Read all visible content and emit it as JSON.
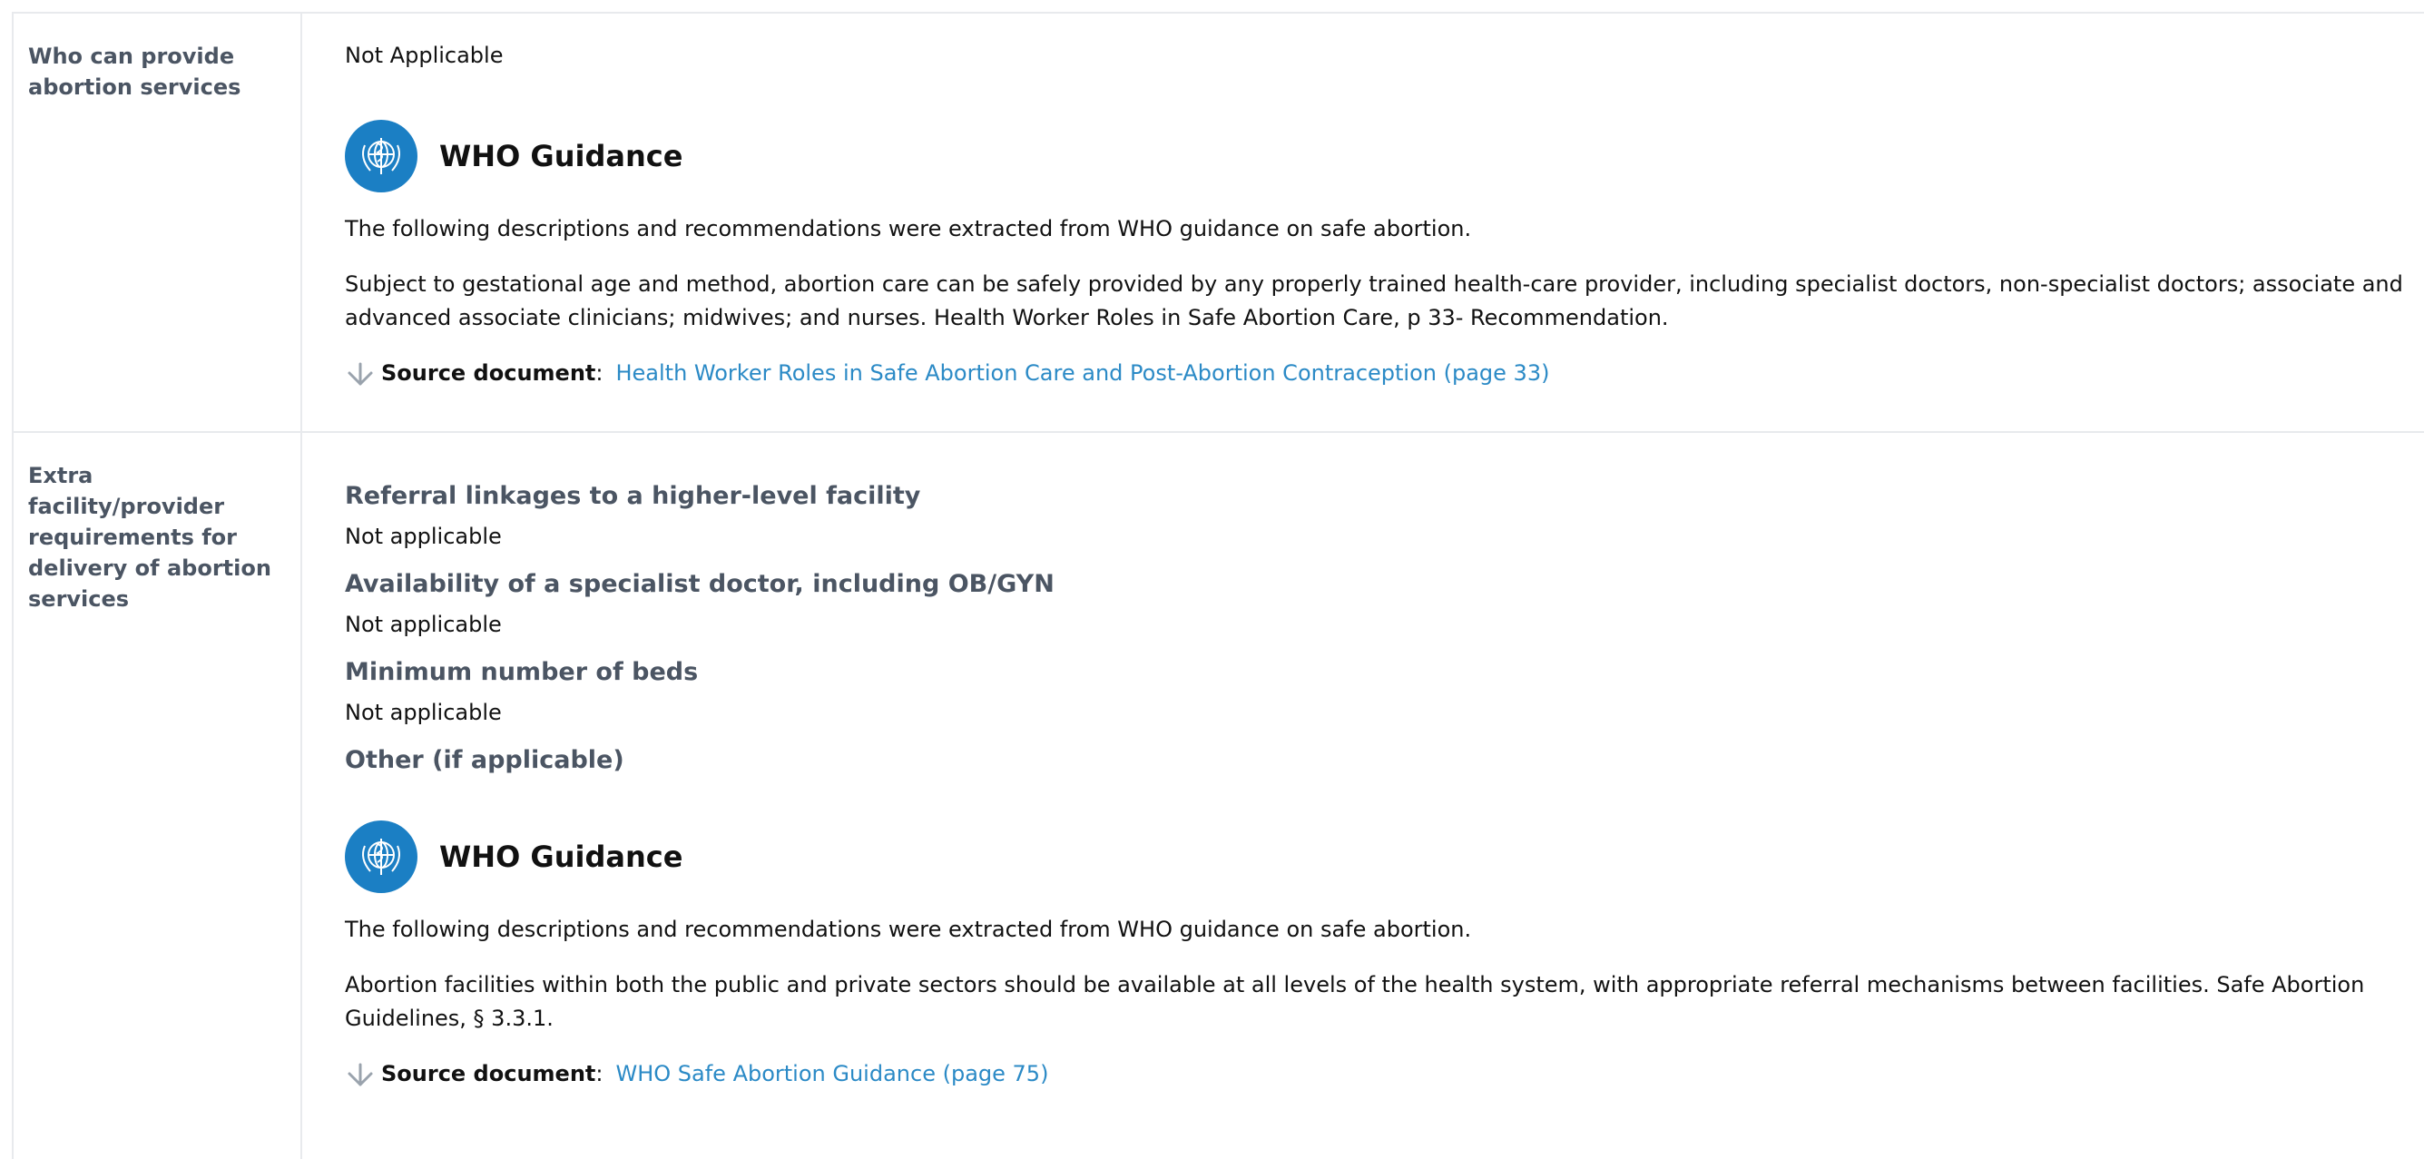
{
  "rows": [
    {
      "label": "Who can provide abortion services",
      "value": "Not Applicable",
      "who": {
        "title": "WHO Guidance",
        "intro": "The following descriptions and recommendations were extracted from WHO guidance on safe abortion.",
        "text": "Subject to gestational age and method, abortion care can be safely provided by any properly trained health-care provider, including specialist doctors, non-specialist doctors; associate and advanced associate clinicians; midwives; and nurses. Health Worker Roles in Safe Abortion Care, p 33- Recommendation.",
        "source_label": "Source document",
        "source_sep": ":",
        "source_link": "Health Worker Roles in Safe Abortion Care and Post-Abortion Contraception (page 33)"
      }
    },
    {
      "label": "Extra facility/provider requirements for delivery of abortion services",
      "subsections": [
        {
          "heading": "Referral linkages to a higher-level facility",
          "value": "Not applicable"
        },
        {
          "heading": "Availability of a specialist doctor, including OB/GYN",
          "value": "Not applicable"
        },
        {
          "heading": "Minimum number of beds",
          "value": "Not applicable"
        },
        {
          "heading": "Other (if applicable)",
          "value": ""
        }
      ],
      "who": {
        "title": "WHO Guidance",
        "intro": "The following descriptions and recommendations were extracted from WHO guidance on safe abortion.",
        "text": "Abortion facilities within both the public and private sectors should be available at all levels of the health system, with appropriate referral mechanisms between facilities. Safe Abortion Guidelines, § 3.3.1.",
        "source_label": "Source document",
        "source_sep": ":",
        "source_link": "WHO Safe Abortion Guidance (page 75)"
      }
    }
  ],
  "colors": {
    "label": "#4b5563",
    "border": "#e8eaed",
    "who_blue": "#1b7fc4",
    "link": "#2b8ac6"
  },
  "icons": {
    "who_logo": "who-emblem-icon",
    "source_arrow": "download-arrow-icon"
  }
}
